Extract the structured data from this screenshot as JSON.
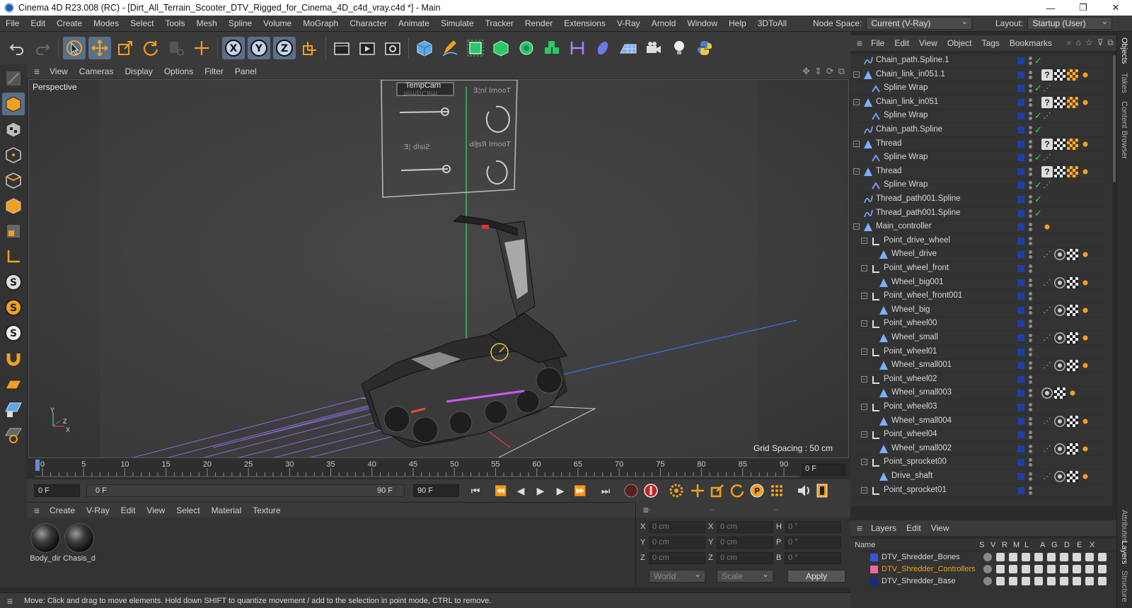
{
  "window": {
    "title": "Cinema 4D R23.008 (RC) - [Dirt_All_Terrain_Scooter_DTV_Rigged_for_Cinema_4D_c4d_vray.c4d *] - Main",
    "minimize": "—",
    "maximize": "❐",
    "close": "✕"
  },
  "menubar": {
    "items": [
      "File",
      "Edit",
      "Create",
      "Modes",
      "Select",
      "Tools",
      "Mesh",
      "Spline",
      "Volume",
      "MoGraph",
      "Character",
      "Animate",
      "Simulate",
      "Tracker",
      "Render",
      "Extensions",
      "V-Ray",
      "Arnold",
      "Window",
      "Help",
      "3DToAll"
    ],
    "node_space_label": "Node Space:",
    "node_space_value": "Current (V-Ray)",
    "layout_label": "Layout:",
    "layout_value": "Startup (User)"
  },
  "viewport": {
    "menu": [
      "View",
      "Cameras",
      "Display",
      "Options",
      "Filter",
      "Panel"
    ],
    "label": "Perspective",
    "camera_label": "TempCam",
    "grid_spacing": "Grid Spacing : 50 cm",
    "axis_y": "Y",
    "axis_z": "Z",
    "axis_x": "X"
  },
  "timeline": {
    "ticks": [
      "0",
      "5",
      "10",
      "15",
      "20",
      "25",
      "30",
      "35",
      "40",
      "45",
      "50",
      "55",
      "60",
      "65",
      "70",
      "75",
      "80",
      "85",
      "90"
    ],
    "current_frame": "0 F"
  },
  "transport": {
    "start_field": "0 F",
    "range_start": "0 F",
    "range_end": "90 F",
    "end_field": "90 F"
  },
  "materials": {
    "menu": [
      "Create",
      "V-Ray",
      "Edit",
      "View",
      "Select",
      "Material",
      "Texture"
    ],
    "items": [
      {
        "name": "Body_dir"
      },
      {
        "name": "Chasis_d"
      }
    ]
  },
  "coords": {
    "header": [
      "--",
      "--",
      "--"
    ],
    "rows": [
      {
        "a": "X",
        "av": "0 cm",
        "b": "X",
        "bv": "0 cm",
        "c": "H",
        "cv": "0 °"
      },
      {
        "a": "Y",
        "av": "0 cm",
        "b": "Y",
        "bv": "0 cm",
        "c": "P",
        "cv": "0 °"
      },
      {
        "a": "Z",
        "av": "0 cm",
        "b": "Z",
        "bv": "0 cm",
        "c": "B",
        "cv": "0 °"
      }
    ],
    "mode": "World",
    "kind": "Scale",
    "apply": "Apply"
  },
  "status": {
    "message": "Move: Click and drag to move elements. Hold down SHIFT to quantize movement / add to the selection in point mode, CTRL to remove."
  },
  "objects": {
    "menu": [
      "File",
      "Edit",
      "View",
      "Object",
      "Tags",
      "Bookmarks"
    ],
    "rows": [
      {
        "name": "Chain_path.Spline.1",
        "indent": 0,
        "type": "spline",
        "expand": "",
        "check": true,
        "tags": []
      },
      {
        "name": "Chain_link_in051.1",
        "indent": 0,
        "type": "mesh",
        "expand": "−",
        "check": false,
        "tags": [
          "q",
          "chk",
          "org",
          "dot"
        ]
      },
      {
        "name": "Spline Wrap",
        "indent": 1,
        "type": "wrap",
        "expand": "",
        "check": true,
        "tags": [
          "sw2"
        ]
      },
      {
        "name": "Chain_link_in051",
        "indent": 0,
        "type": "mesh",
        "expand": "−",
        "check": false,
        "tags": [
          "q",
          "chk",
          "org",
          "dot"
        ]
      },
      {
        "name": "Spline Wrap",
        "indent": 1,
        "type": "wrap",
        "expand": "",
        "check": true,
        "tags": [
          "sw2"
        ]
      },
      {
        "name": "Chain_path.Spline",
        "indent": 0,
        "type": "spline",
        "expand": "",
        "check": true,
        "tags": []
      },
      {
        "name": "Thread",
        "indent": 0,
        "type": "mesh",
        "expand": "−",
        "check": false,
        "tags": [
          "q",
          "chk",
          "org",
          "dot"
        ]
      },
      {
        "name": "Spline Wrap",
        "indent": 1,
        "type": "wrap",
        "expand": "",
        "check": true,
        "tags": [
          "sw2"
        ]
      },
      {
        "name": "Thread",
        "indent": 0,
        "type": "mesh",
        "expand": "−",
        "check": false,
        "tags": [
          "q",
          "chk",
          "org",
          "dot"
        ]
      },
      {
        "name": "Spline Wrap",
        "indent": 1,
        "type": "wrap",
        "expand": "",
        "check": true,
        "tags": [
          "sw2"
        ]
      },
      {
        "name": "Thread_path001.Spline",
        "indent": 0,
        "type": "spline",
        "expand": "",
        "check": true,
        "tags": []
      },
      {
        "name": "Thread_path001.Spline",
        "indent": 0,
        "type": "spline",
        "expand": "",
        "check": true,
        "tags": []
      },
      {
        "name": "Main_controller",
        "indent": 0,
        "type": "mesh",
        "expand": "−",
        "check": false,
        "tags": [
          "dot"
        ]
      },
      {
        "name": "Point_drive_wheel",
        "indent": 1,
        "type": "null",
        "expand": "−",
        "check": false,
        "tags": []
      },
      {
        "name": "Wheel_drive",
        "indent": 2,
        "type": "mesh",
        "expand": "",
        "check": false,
        "tags": [
          "sw2",
          "ring",
          "chk",
          "dot"
        ]
      },
      {
        "name": "Point_wheel_front",
        "indent": 1,
        "type": "null",
        "expand": "−",
        "check": false,
        "tags": []
      },
      {
        "name": "Wheel_big001",
        "indent": 2,
        "type": "mesh",
        "expand": "",
        "check": false,
        "tags": [
          "sw2",
          "ring",
          "chk",
          "dot"
        ]
      },
      {
        "name": "Point_wheel_front001",
        "indent": 1,
        "type": "null",
        "expand": "−",
        "check": false,
        "tags": []
      },
      {
        "name": "Wheel_big",
        "indent": 2,
        "type": "mesh",
        "expand": "",
        "check": false,
        "tags": [
          "sw2",
          "ring",
          "chk",
          "dot"
        ]
      },
      {
        "name": "Point_wheel00",
        "indent": 1,
        "type": "null",
        "expand": "−",
        "check": false,
        "tags": []
      },
      {
        "name": "Wheel_small",
        "indent": 2,
        "type": "mesh",
        "expand": "",
        "check": false,
        "tags": [
          "sw2",
          "ring",
          "chk",
          "dot"
        ]
      },
      {
        "name": "Point_wheel01",
        "indent": 1,
        "type": "null",
        "expand": "−",
        "check": false,
        "tags": []
      },
      {
        "name": "Wheel_small001",
        "indent": 2,
        "type": "mesh",
        "expand": "",
        "check": false,
        "tags": [
          "sw2",
          "ring",
          "chk",
          "dot"
        ]
      },
      {
        "name": "Point_wheel02",
        "indent": 1,
        "type": "null",
        "expand": "−",
        "check": false,
        "tags": []
      },
      {
        "name": "Wheel_small003",
        "indent": 2,
        "type": "mesh",
        "expand": "",
        "check": false,
        "tags": [
          "ring",
          "chk",
          "dot"
        ]
      },
      {
        "name": "Point_wheel03",
        "indent": 1,
        "type": "null",
        "expand": "−",
        "check": false,
        "tags": []
      },
      {
        "name": "Wheel_small004",
        "indent": 2,
        "type": "mesh",
        "expand": "",
        "check": false,
        "tags": [
          "sw2",
          "ring",
          "chk",
          "dot"
        ]
      },
      {
        "name": "Point_wheel04",
        "indent": 1,
        "type": "null",
        "expand": "−",
        "check": false,
        "tags": []
      },
      {
        "name": "Wheel_small002",
        "indent": 2,
        "type": "mesh",
        "expand": "",
        "check": false,
        "tags": [
          "sw2",
          "ring",
          "chk",
          "dot"
        ]
      },
      {
        "name": "Point_sprocket00",
        "indent": 1,
        "type": "null",
        "expand": "−",
        "check": false,
        "tags": []
      },
      {
        "name": "Drive_shaft",
        "indent": 2,
        "type": "mesh",
        "expand": "",
        "check": false,
        "tags": [
          "sw2",
          "ring",
          "chk",
          "dot"
        ]
      },
      {
        "name": "Point_sprocket01",
        "indent": 1,
        "type": "null",
        "expand": "−",
        "check": false,
        "tags": []
      }
    ]
  },
  "right_tabs": [
    "Objects",
    "Takes",
    "Content Browser",
    "Attributes",
    "Layers",
    "Structure"
  ],
  "layers": {
    "menu": [
      "Layers",
      "Edit",
      "View"
    ],
    "columns": [
      "Name",
      "S",
      "V",
      "R",
      "M",
      "L",
      "A",
      "G",
      "D",
      "E",
      "X"
    ],
    "rows": [
      {
        "name": "DTV_Shredder_Bones",
        "color": "#3355dd",
        "text_color": "#d8d8d8"
      },
      {
        "name": "DTV_Shredder_Controllers",
        "color": "#e86a9a",
        "text_color": "#f0a020"
      },
      {
        "name": "DTV_Shredder_Base",
        "color": "#1a2a8a",
        "text_color": "#d8d8d8"
      }
    ]
  }
}
